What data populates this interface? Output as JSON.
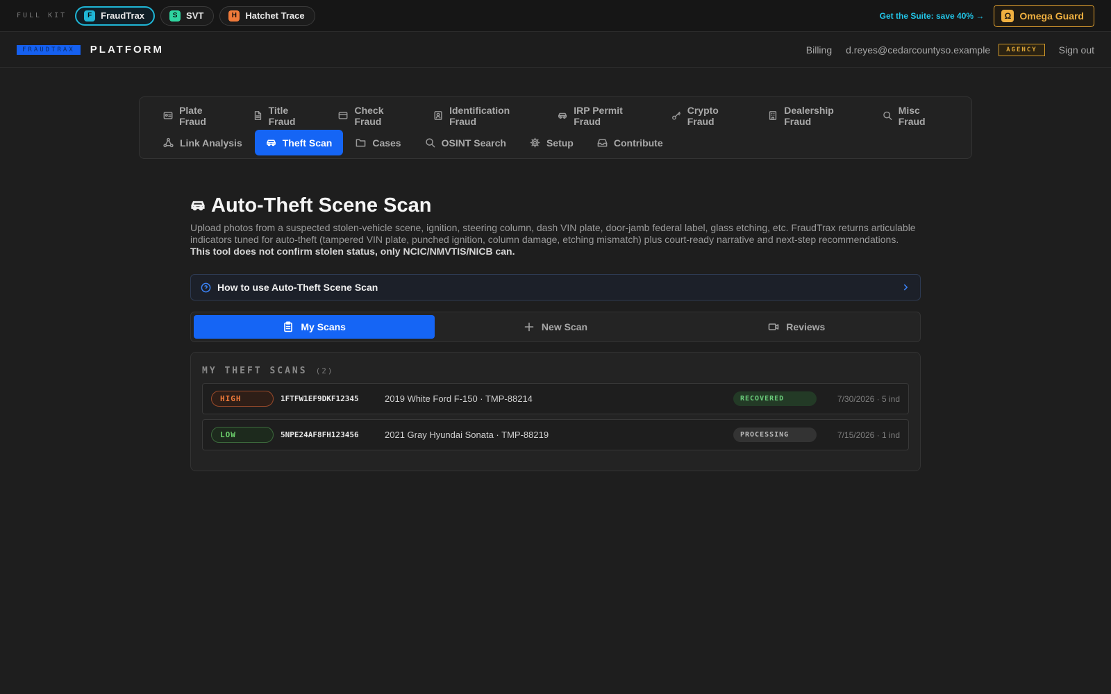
{
  "suite": {
    "label": "FULL KIT",
    "apps": [
      {
        "name": "FraudTrax",
        "badge": "F",
        "color": "#1fb6d6",
        "active": true
      },
      {
        "name": "SVT",
        "badge": "S",
        "color": "#2fd6a0",
        "active": false
      },
      {
        "name": "Hatchet Trace",
        "badge": "H",
        "color": "#f07a3a",
        "active": false
      }
    ],
    "promo": "Get the Suite: save 40% →",
    "omega": {
      "badge": "Ω",
      "label": "Omega Guard"
    }
  },
  "platform": {
    "logo": "FRAUDTRAX",
    "title": "PLATFORM",
    "billing": "Billing",
    "email": "d.reyes@cedarcountyso.example",
    "role": "AGENCY",
    "signout": "Sign out"
  },
  "nav": {
    "row1": [
      {
        "label": "Plate Fraud",
        "icon": "id-card-icon"
      },
      {
        "label": "Title Fraud",
        "icon": "document-icon"
      },
      {
        "label": "Check Fraud",
        "icon": "credit-card-icon"
      },
      {
        "label": "Identification Fraud",
        "icon": "id-badge-icon"
      },
      {
        "label": "IRP Permit Fraud",
        "icon": "car-icon"
      },
      {
        "label": "Crypto Fraud",
        "icon": "key-icon"
      },
      {
        "label": "Dealership Fraud",
        "icon": "building-icon"
      },
      {
        "label": "Misc Fraud",
        "icon": "search-icon"
      }
    ],
    "row2": [
      {
        "label": "Link Analysis",
        "icon": "network-icon"
      },
      {
        "label": "Theft Scan",
        "icon": "car-icon",
        "active": true
      },
      {
        "label": "Cases",
        "icon": "folder-icon"
      },
      {
        "label": "OSINT Search",
        "icon": "search-icon"
      },
      {
        "label": "Setup",
        "icon": "gear-icon"
      },
      {
        "label": "Contribute",
        "icon": "inbox-icon"
      }
    ]
  },
  "page": {
    "title": "Auto-Theft Scene Scan",
    "description": "Upload photos from a suspected stolen-vehicle scene, ignition, steering column, dash VIN plate, door-jamb federal label, glass etching, etc. FraudTrax returns articulable indicators tuned for auto-theft (tampered VIN plate, punched ignition, column damage, etching mismatch) plus court-ready narrative and next-step recommendations.",
    "disclaimer": "This tool does not confirm stolen status, only NCIC/NMVTIS/NICB can.",
    "howto": "How to use Auto-Theft Scene Scan"
  },
  "tabs": [
    {
      "label": "My Scans",
      "icon": "clipboard-icon",
      "active": true
    },
    {
      "label": "New Scan",
      "icon": "plus-icon"
    },
    {
      "label": "Reviews",
      "icon": "video-icon"
    }
  ],
  "scans": {
    "heading": "MY THEFT SCANS",
    "count": "(2)",
    "rows": [
      {
        "risk": "HIGH",
        "vin": "1FTFW1EF9DKF12345",
        "vehicle": "2019 White Ford F-150 · TMP-88214",
        "status": "RECOVERED",
        "meta": "7/30/2026 · 5 ind"
      },
      {
        "risk": "LOW",
        "vin": "5NPE24AF8FH123456",
        "vehicle": "2021 Gray Hyundai Sonata · TMP-88219",
        "status": "PROCESSING",
        "meta": "7/15/2026 · 1 ind"
      }
    ]
  }
}
